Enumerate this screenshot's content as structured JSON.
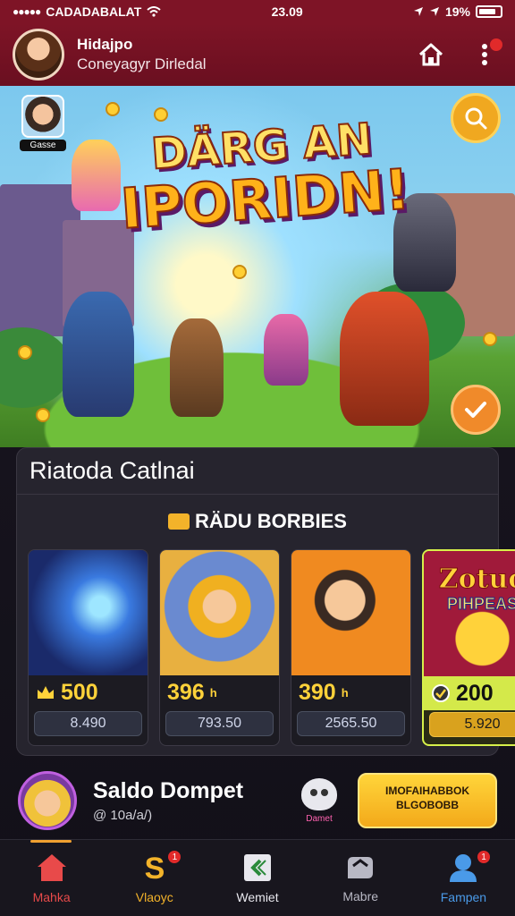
{
  "status_bar": {
    "carrier": "CADADABALAT",
    "time": "23.09",
    "battery": "19%"
  },
  "header": {
    "user_name": "Hidajpo",
    "user_subtitle": "Coneyagyr Dirledal"
  },
  "hero": {
    "title_line1": "DÄRG AN",
    "title_line2": "IPORIDN!",
    "mini_avatar_label": "Gasse"
  },
  "panel": {
    "title": "Riatoda Catlnai",
    "subtitle": "RÄDU BORBIES",
    "cards": [
      {
        "price": "500",
        "sub": "8.490"
      },
      {
        "price": "396",
        "price_suffix": "h",
        "sub": "793.50"
      },
      {
        "price": "390",
        "price_suffix": "h",
        "sub": "2565.50"
      },
      {
        "price": "200",
        "sub": "5.920",
        "image_text_1": "Zotuo",
        "image_text_2": "PIHPEAS"
      }
    ]
  },
  "wallet": {
    "title": "Saldo Dompet",
    "amount": "@ 10a/a/)",
    "pet_label": "Damet",
    "button_label": "IMOFAIHABBOK BLGOBOBB"
  },
  "nav": {
    "items": [
      {
        "label": "Mahka",
        "color": "#e84a4a"
      },
      {
        "label": "Vlaoyc",
        "color": "#f3b32a",
        "badge": "1"
      },
      {
        "label": "Wemiet",
        "color": "#e8e8ee"
      },
      {
        "label": "Mabre",
        "color": "#b8b8c4"
      },
      {
        "label": "Fampen",
        "color": "#4a9ae8",
        "badge": "1"
      }
    ]
  },
  "colors": {
    "header": "#7e1426",
    "accent_gold": "#f3b32a",
    "panel_bg": "#26242e",
    "nav_bg": "#18161e"
  }
}
